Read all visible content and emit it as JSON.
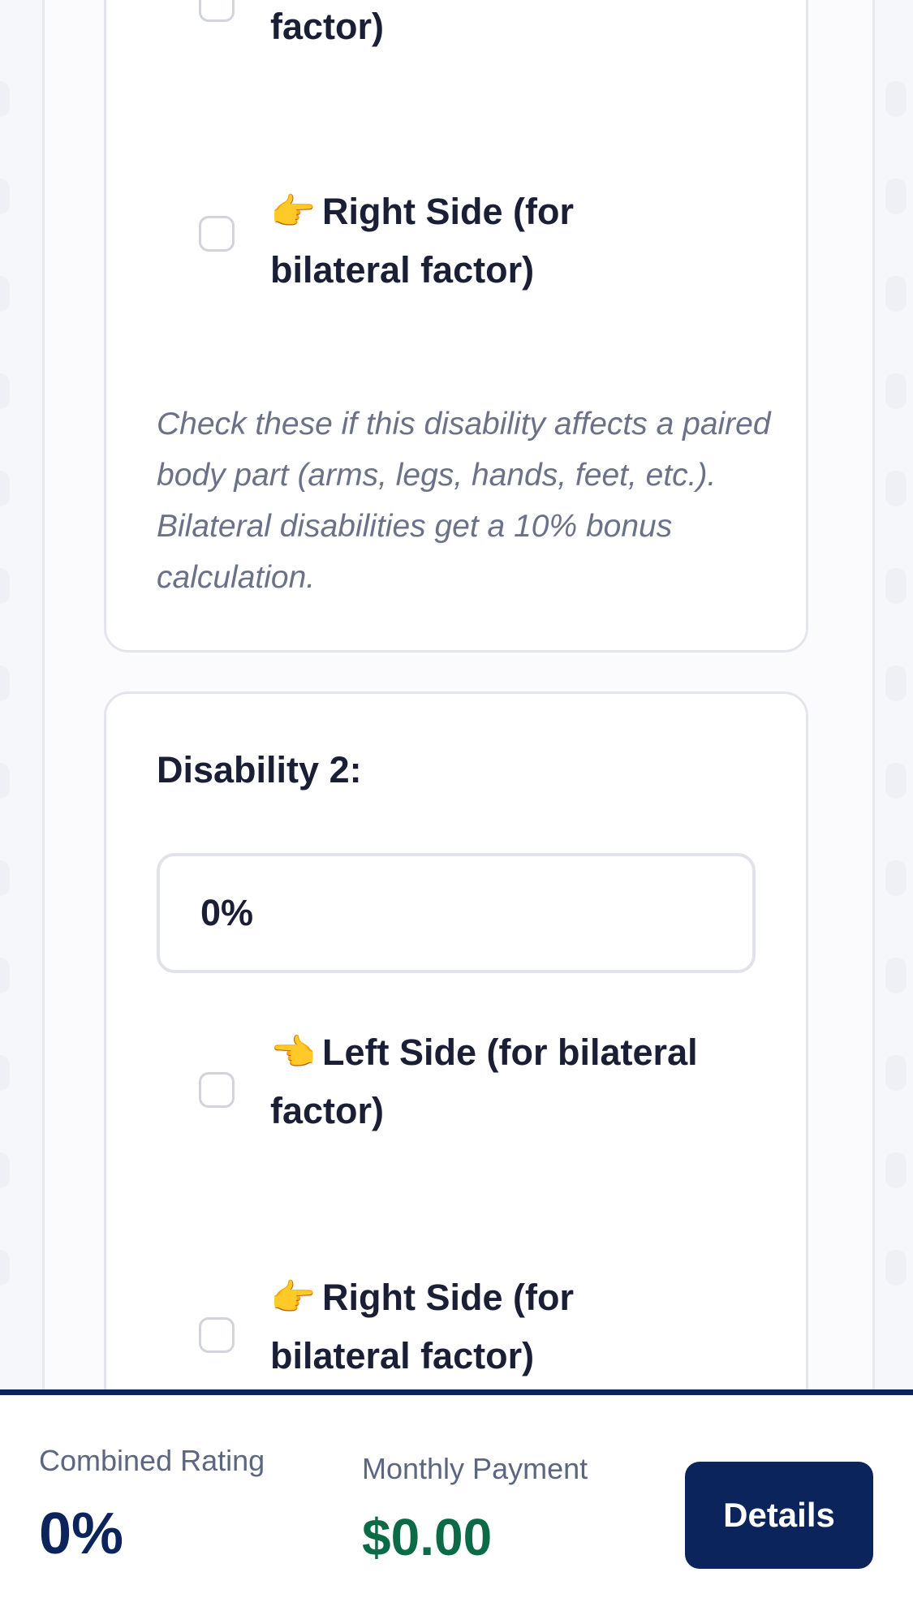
{
  "disability1": {
    "left_side_label_tail": "factor)",
    "right_side_hand": "👉",
    "right_side_label": "Right Side (for bilateral factor)",
    "help_text": "Check these if this disability affects a paired body part (arms, legs, hands, feet, etc.). Bilateral disabilities get a 10% bonus calculation."
  },
  "disability2": {
    "title": "Disability 2:",
    "rating_value": "0%",
    "left_side_hand": "👈",
    "left_side_label": "Left Side (for bilateral factor)",
    "right_side_hand": "👉",
    "right_side_label": "Right Side (for bilateral factor)"
  },
  "summary": {
    "combined_label": "Combined Rating",
    "combined_value": "0%",
    "monthly_label": "Monthly Payment",
    "monthly_value": "$0.00",
    "details_label": "Details"
  },
  "colors": {
    "brand_navy": "#0b245c",
    "payment_green": "#0b6b46",
    "accent_hand": "#f2b632"
  }
}
